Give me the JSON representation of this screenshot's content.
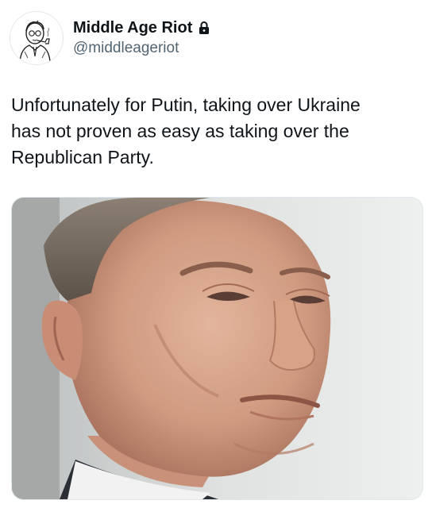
{
  "tweet": {
    "author": {
      "display_name": "Middle Age Riot",
      "handle": "@middleageriot",
      "protected_icon": "lock-icon",
      "avatar_icon": "avatar-cartoon-man-icon"
    },
    "text": "Unfortunately for Putin, taking over Ukraine\nhas not proven as easy as taking over the\nRepublican Party.",
    "media": {
      "type": "photo",
      "icon": "portrait-photo"
    }
  },
  "colors": {
    "text_primary": "#0f1419",
    "text_secondary": "#536471",
    "background": "#ffffff"
  }
}
